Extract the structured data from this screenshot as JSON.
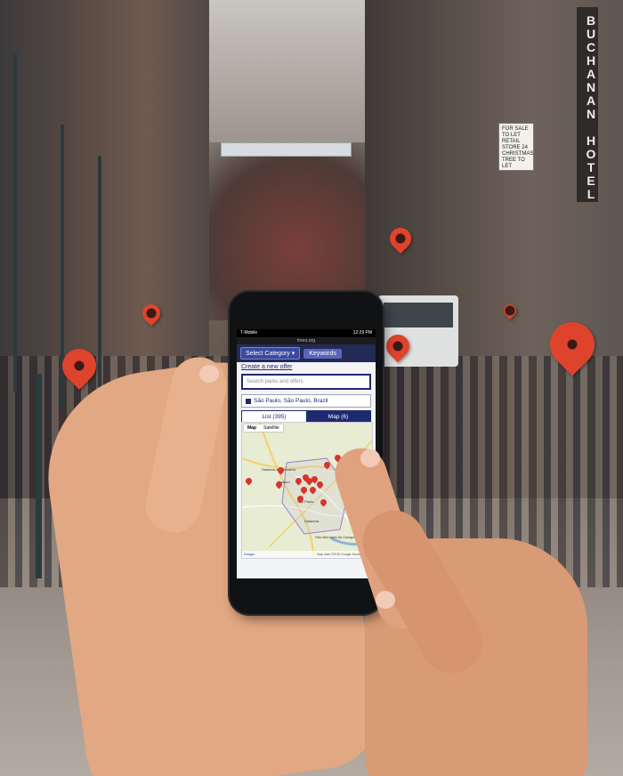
{
  "scene": {
    "hotel_sign": "BUCHANAN HOTEL",
    "sale_sign": "FOR SALE TO LET RETAIL STORE 24 CHRISTMAS TREE TO LET"
  },
  "phone": {
    "status": {
      "left": "T-Mobile",
      "right": "12:29 PM"
    },
    "url": "freeu.org",
    "toolbar": {
      "select_category": "Select Category ▾",
      "keywords": "Keywords"
    },
    "create_link": "Create a new offer",
    "search": {
      "placeholder": "Search parks and offers"
    },
    "location": "São Paulo, São Paulo, Brazil",
    "tabs": {
      "list": "List (395)",
      "map": "Map (6)"
    },
    "map": {
      "toggle_map": "Map",
      "toggle_satellite": "Satellite",
      "labels": [
        "Santana de Parnaíba",
        "Osasco",
        "São Paulo",
        "Diadema",
        "São Bernardo do Campo"
      ],
      "footer_logo": "Google",
      "footer_text": "Map data ©2015 Google Terms of Use",
      "zoom_in": "+",
      "zoom_out": "−"
    }
  },
  "colors": {
    "accent": "#1e2a6e",
    "pin": "#d8342a"
  },
  "icons": [
    "location-pin-icon",
    "pegman-icon",
    "chevron-down-icon"
  ]
}
